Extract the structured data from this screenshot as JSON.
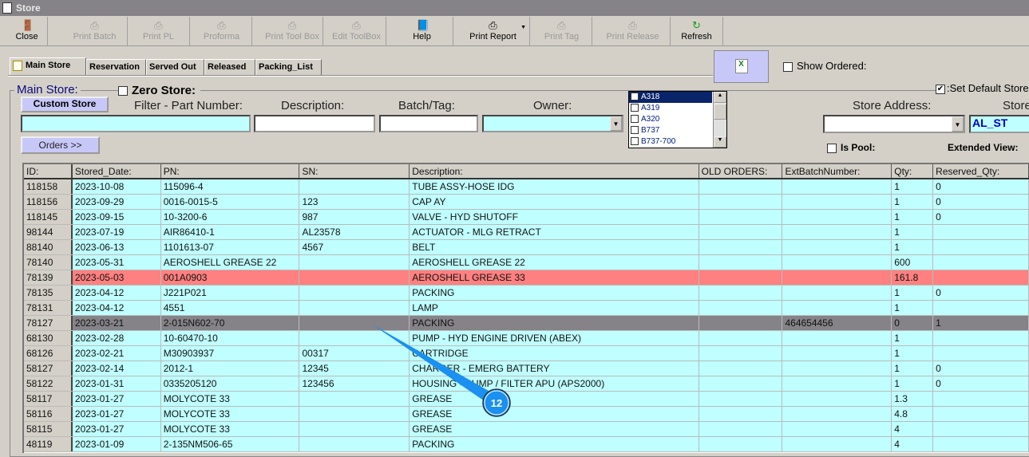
{
  "window": {
    "title": "Store"
  },
  "toolbar": [
    {
      "label": "Close",
      "icon": "door-exit-icon",
      "enabled": true
    },
    {
      "label": "Print Batch",
      "icon": "printer-icon",
      "enabled": false
    },
    {
      "label": "Print PL",
      "icon": "printer-icon",
      "enabled": false
    },
    {
      "label": "Proforma",
      "icon": "printer-icon",
      "enabled": false
    },
    {
      "label": "Print Tool Box",
      "icon": "printer-icon",
      "enabled": false
    },
    {
      "label": "Edit ToolBox",
      "icon": "printer-icon",
      "enabled": false
    },
    {
      "label": "Help",
      "icon": "help-book-icon",
      "enabled": true
    },
    {
      "label": "Print Report",
      "icon": "printer-icon",
      "enabled": true
    },
    {
      "label": "Print Tag",
      "icon": "printer-icon",
      "enabled": false
    },
    {
      "label": "Print Release",
      "icon": "printer-icon",
      "enabled": false
    },
    {
      "label": "Refresh",
      "icon": "refresh-icon",
      "enabled": true
    }
  ],
  "tabs": [
    "Main Store",
    "Reservation",
    "Served Out",
    "Released",
    "Packing_List"
  ],
  "filters": {
    "group_title": "Main Store:",
    "zero_store": "Zero Store:",
    "custom_store": "Custom Store",
    "part_number_label": "Filter - Part Number:",
    "description_label": "Description:",
    "batch_label": "Batch/Tag:",
    "owner_label": "Owner:",
    "orders_button": "Orders >>",
    "show_ordered": "Show Ordered:",
    "set_default_store": ":Set Default Store",
    "store_address_label": "Store Address:",
    "store_label": "Store",
    "store_value": "AL_ST",
    "is_pool": "Is Pool:",
    "extended_view": "Extended View:",
    "owner_options": [
      "A318",
      "A319",
      "A320",
      "B737",
      "B737-700"
    ]
  },
  "table": {
    "columns": [
      "ID:",
      "Stored_Date:",
      "PN:",
      "SN:",
      "Description:",
      "OLD ORDERS:",
      "ExtBatchNumber:",
      "Qty:",
      "Reserved_Qty:"
    ],
    "rows": [
      [
        "118158",
        "2023-10-08",
        "115096-4",
        "",
        "TUBE ASSY-HOSE IDG",
        "",
        "",
        "1",
        "0"
      ],
      [
        "118156",
        "2023-09-29",
        "0016-0015-5",
        "123",
        "CAP AY",
        "",
        "",
        "1",
        "0"
      ],
      [
        "118145",
        "2023-09-15",
        "10-3200-6",
        "987",
        "VALVE - HYD SHUTOFF",
        "",
        "",
        "1",
        "0"
      ],
      [
        "98144",
        "2023-07-19",
        "AIR86410-1",
        "AL23578",
        "ACTUATOR - MLG RETRACT",
        "",
        "",
        "1",
        ""
      ],
      [
        "88140",
        "2023-06-13",
        "1101613-07",
        "4567",
        "BELT",
        "",
        "",
        "1",
        ""
      ],
      [
        "78140",
        "2023-05-31",
        "AEROSHELL GREASE 22",
        "",
        "AEROSHELL GREASE 22",
        "",
        "",
        "600",
        ""
      ],
      [
        "78139",
        "2023-05-03",
        "001A0903",
        "",
        "AEROSHELL GREASE 33",
        "",
        "",
        "161.8",
        ""
      ],
      [
        "78135",
        "2023-04-12",
        "J221P021",
        "",
        "PACKING",
        "",
        "",
        "1",
        "0"
      ],
      [
        "78131",
        "2023-04-12",
        "4551",
        "",
        "LAMP",
        "",
        "",
        "1",
        ""
      ],
      [
        "78127",
        "2023-03-21",
        "2-015N602-70",
        "",
        "PACKING",
        "",
        "464654456",
        "0",
        "1"
      ],
      [
        "68130",
        "2023-02-28",
        "10-60470-10",
        "",
        "PUMP - HYD ENGINE DRIVEN (ABEX)",
        "",
        "",
        "1",
        ""
      ],
      [
        "68126",
        "2023-02-21",
        "M30903937",
        "00317",
        "CARTRIDGE",
        "",
        "",
        "1",
        ""
      ],
      [
        "58127",
        "2023-02-14",
        "2012-1",
        "12345",
        "CHARGER - EMERG BATTERY",
        "",
        "",
        "1",
        "0"
      ],
      [
        "58122",
        "2023-01-31",
        "0335205120",
        "123456",
        "HOUSING - PUMP / FILTER APU (APS2000)",
        "",
        "",
        "1",
        "0"
      ],
      [
        "58117",
        "2023-01-27",
        "MOLYCOTE 33",
        "",
        "GREASE",
        "",
        "",
        "1.3",
        ""
      ],
      [
        "58116",
        "2023-01-27",
        "MOLYCOTE 33",
        "",
        "GREASE",
        "",
        "",
        "4.8",
        ""
      ],
      [
        "58115",
        "2023-01-27",
        "MOLYCOTE 33",
        "",
        "GREASE",
        "",
        "",
        "4",
        ""
      ],
      [
        "48119",
        "2023-01-09",
        "2-135NM506-65",
        "",
        "PACKING",
        "",
        "",
        "4",
        ""
      ]
    ],
    "row_states": {
      "78139": "red",
      "78127": "selected"
    }
  },
  "callout": {
    "label": "12",
    "color": "#1a90f0"
  }
}
